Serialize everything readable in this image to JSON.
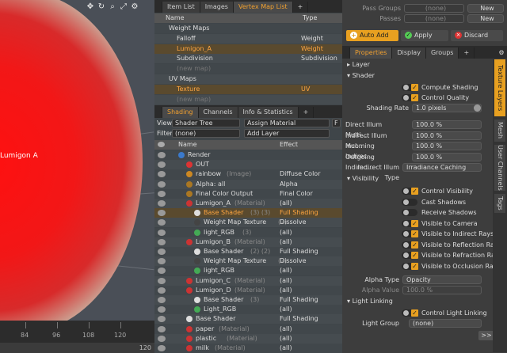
{
  "viewport": {
    "label_fragment": "Lumigon A",
    "icons": [
      "move-icon",
      "rotate-icon",
      "search-icon",
      "expand-icon",
      "gear-icon"
    ],
    "ruler_labels": [
      "84",
      "96",
      "108",
      "120"
    ],
    "ruler_end": "120"
  },
  "vmap": {
    "tabs": [
      "Item List",
      "Images",
      "Vertex Map List"
    ],
    "tab_plus": "+",
    "columns": {
      "name": "Name",
      "type": "Type"
    },
    "rows": [
      {
        "name": "Weight Maps",
        "type": "",
        "indent": 0,
        "group": true
      },
      {
        "name": "Falloff",
        "type": "Weight",
        "indent": 1
      },
      {
        "name": "Lumigon_A",
        "type": "Weight",
        "indent": 1,
        "selected": true
      },
      {
        "name": "Subdivision",
        "type": "Subdivision",
        "indent": 1
      },
      {
        "name": "(new map)",
        "type": "",
        "indent": 1,
        "dim": true
      },
      {
        "name": "UV Maps",
        "type": "",
        "indent": 0,
        "group": true
      },
      {
        "name": "Texture",
        "type": "UV",
        "indent": 1,
        "selected": true
      },
      {
        "name": "(new map)",
        "type": "",
        "indent": 1,
        "dim": true
      }
    ]
  },
  "shading": {
    "tabs": [
      "Shading",
      "Channels",
      "Info & Statistics"
    ],
    "tab_plus": "+",
    "view_label": "View",
    "view_value": "Shader Tree",
    "assign_material": "Assign Material",
    "filter_label": "Filter",
    "filter_value": "(none)",
    "add_layer": "Add Layer",
    "f_button": "F",
    "columns": {
      "name": "Name",
      "effect": "Effect"
    },
    "rows": [
      {
        "name": "Render",
        "tag": "",
        "effect": "",
        "indent": 0,
        "ball": "#3a7acc"
      },
      {
        "name": "OUT",
        "tag": "",
        "effect": "",
        "indent": 1,
        "ball": "#dd3333"
      },
      {
        "name": "rainbow",
        "tag": "(Image)",
        "effect": "Diffuse Color",
        "indent": 1,
        "ball": "#cc8822"
      },
      {
        "name": "Alpha: all",
        "tag": "",
        "effect": "Alpha",
        "indent": 1,
        "ball": "#aa7722"
      },
      {
        "name": "Final Color Output",
        "tag": "",
        "effect": "Final Color",
        "indent": 1,
        "ball": "#aa7722"
      },
      {
        "name": "Lumigon_A",
        "tag": "(Material)",
        "effect": "(all)",
        "indent": 1,
        "ball": "#cc3333"
      },
      {
        "name": "Base Shader",
        "tag": "(3) (3)",
        "effect": "Full Shading",
        "indent": 2,
        "ball": "#dddddd",
        "selected": true
      },
      {
        "name": "Weight Map Texture",
        "tag": "(2)",
        "effect": "Dissolve",
        "indent": 2,
        "ball": "#444444"
      },
      {
        "name": "light_RGB",
        "tag": "(3)",
        "effect": "(all)",
        "indent": 2,
        "ball": "#44aa55"
      },
      {
        "name": "Lumigon_B",
        "tag": "(Material)",
        "effect": "(all)",
        "indent": 1,
        "ball": "#cc3333"
      },
      {
        "name": "Base Shader",
        "tag": "(2) (2)",
        "effect": "Full Shading",
        "indent": 2,
        "ball": "#dddddd"
      },
      {
        "name": "Weight Map Texture",
        "tag": "(2)",
        "effect": "Dissolve",
        "indent": 2,
        "ball": "#444444"
      },
      {
        "name": "light_RGB",
        "tag": "",
        "effect": "(all)",
        "indent": 2,
        "ball": "#44aa55"
      },
      {
        "name": "Lumigon_C",
        "tag": "(Material)",
        "effect": "(all)",
        "indent": 1,
        "ball": "#cc3333"
      },
      {
        "name": "Lumigon_D",
        "tag": "(Material)",
        "effect": "(all)",
        "indent": 1,
        "ball": "#cc3333"
      },
      {
        "name": "Base Shader",
        "tag": "(3)",
        "effect": "Full Shading",
        "indent": 2,
        "ball": "#dddddd"
      },
      {
        "name": "Light_RGB",
        "tag": "",
        "effect": "(all)",
        "indent": 2,
        "ball": "#44aa55"
      },
      {
        "name": "Base Shader",
        "tag": "",
        "effect": "Full Shading",
        "indent": 1,
        "ball": "#dddddd"
      },
      {
        "name": "paper",
        "tag": "(Material)",
        "effect": "(all)",
        "indent": 1,
        "ball": "#cc3333"
      },
      {
        "name": "plastic",
        "tag": "(Material)",
        "effect": "(all)",
        "indent": 1,
        "ball": "#cc3333"
      },
      {
        "name": "milk",
        "tag": "(Material)",
        "effect": "(all)",
        "indent": 1,
        "ball": "#cc3333"
      }
    ]
  },
  "right": {
    "pass_groups_label": "Pass Groups",
    "pass_groups_value": "(none)",
    "passes_label": "Passes",
    "passes_value": "(none)",
    "new1": "New",
    "new2": "New",
    "auto_add": "Auto Add",
    "apply": "Apply",
    "discard": "Discard",
    "tabs": [
      "Properties",
      "Display",
      "Groups"
    ],
    "tab_plus": "+",
    "layer_section": "Layer",
    "shader_section": "Shader",
    "compute_shading": "Compute Shading",
    "control_quality": "Control Quality",
    "shading_rate_label": "Shading Rate",
    "shading_rate_value": "1.0 pixels",
    "fields": [
      {
        "label": "Direct Illum Multi ...",
        "value": "100.0 %"
      },
      {
        "label": "Indirect Illum Mul...",
        "value": "100.0 %"
      },
      {
        "label": "Incoming Indirec...",
        "value": "100.0 %"
      },
      {
        "label": "Outgoing Indirec...",
        "value": "100.0 %"
      }
    ],
    "indirect_type_label": "Indirect Illum Type",
    "indirect_type_value": "Irradiance Caching",
    "visibility_section": "Visibility",
    "visibility_items": [
      {
        "label": "Control Visibility",
        "checked": true
      },
      {
        "label": "Cast Shadows",
        "checked": false
      },
      {
        "label": "Receive Shadows",
        "checked": false
      },
      {
        "label": "Visible to Camera",
        "checked": true
      },
      {
        "label": "Visible to Indirect Rays",
        "checked": true
      },
      {
        "label": "Visible to Reflection Rays",
        "checked": true
      },
      {
        "label": "Visible to Refraction Rays",
        "checked": true
      },
      {
        "label": "Visible to Occlusion Rays",
        "checked": true
      }
    ],
    "alpha_type_label": "Alpha Type",
    "alpha_type_value": "Opacity",
    "alpha_value_label": "Alpha Value",
    "alpha_value_value": "100.0 %",
    "light_linking_section": "Light Linking",
    "control_light_linking": "Control Light Linking",
    "light_group_label": "Light Group",
    "light_group_value": "(none)",
    "more_button": ">>",
    "vertical_tabs": [
      "Texture Layers",
      "Mesh",
      "User Channels",
      "Tags"
    ]
  },
  "colors": {
    "accent": "#e8a020",
    "selected_text": "#ffa640"
  }
}
